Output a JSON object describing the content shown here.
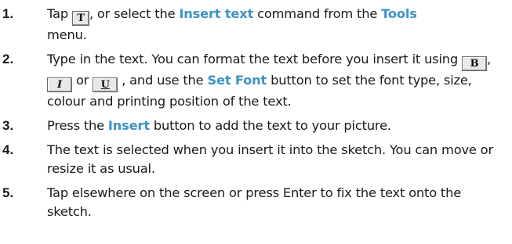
{
  "steps": [
    {
      "number": "1.",
      "parts": [
        "Tap ",
        ", or select the ",
        "Insert text",
        " command from the ",
        "Tools",
        " menu."
      ],
      "icon": "text-tool-icon",
      "icon_glyph": "T"
    },
    {
      "number": "2.",
      "parts": [
        "Type in the text. You can format the text before you insert it using ",
        ", ",
        " or ",
        " , and use the ",
        "Set Font",
        " button to set the font type, size, colour and printing position of the text."
      ],
      "icons": [
        {
          "name": "bold-icon",
          "glyph": "B"
        },
        {
          "name": "italic-icon",
          "glyph": "I"
        },
        {
          "name": "underline-icon",
          "glyph": "U"
        }
      ]
    },
    {
      "number": "3.",
      "parts": [
        "Press the ",
        "Insert",
        " button to add the text to your picture."
      ]
    },
    {
      "number": "4.",
      "text": "The text is selected when you insert it into the sketch. You can move or resize it as usual."
    },
    {
      "number": "5.",
      "text": "Tap elsewhere on the screen or press Enter to fix the text onto the sketch."
    }
  ],
  "colors": {
    "highlight": "#3d93c6",
    "body_text": "#1a1a1a"
  }
}
